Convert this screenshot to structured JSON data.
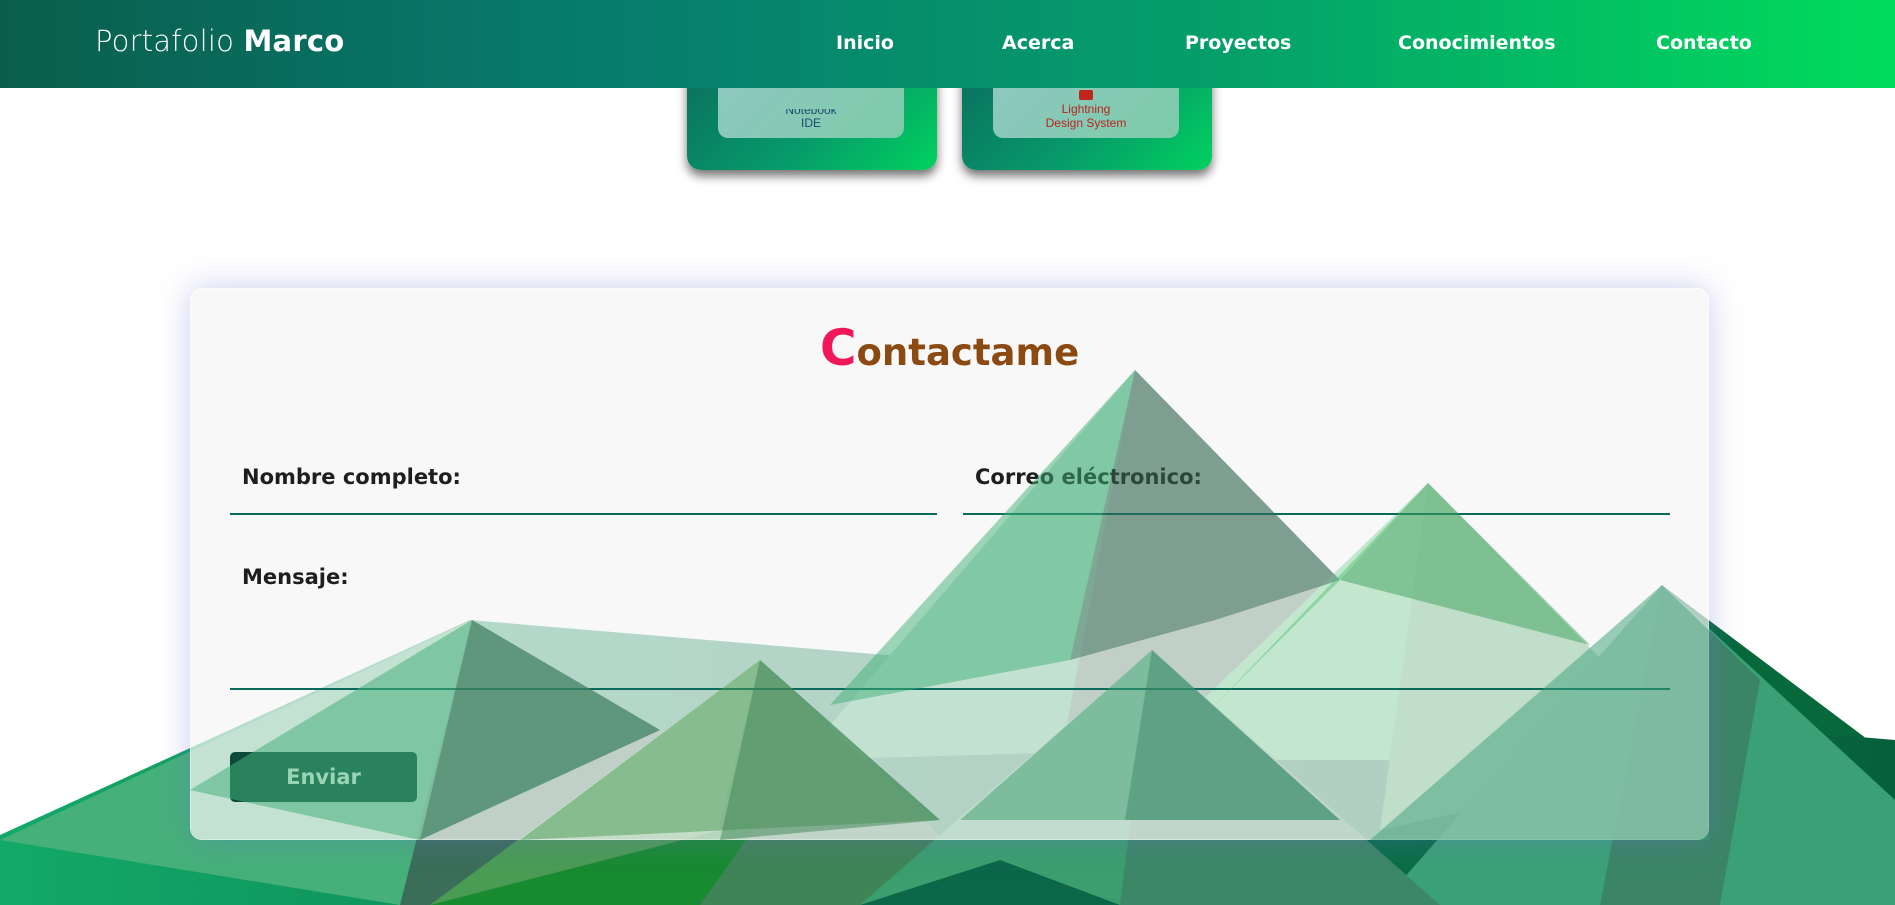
{
  "header": {
    "brand_light": "Portafolio",
    "brand_bold": "Marco",
    "nav": [
      {
        "label": "Inicio"
      },
      {
        "label": "Acerca"
      },
      {
        "label": "Proyectos"
      },
      {
        "label": "Conocimientos"
      },
      {
        "label": "Contacto"
      }
    ]
  },
  "projects": [
    {
      "label_line1": "Notebook",
      "label_line2": "IDE"
    },
    {
      "label_line1": "Lightning",
      "label_line2": "Design System"
    }
  ],
  "contact": {
    "title_first": "C",
    "title_rest": "ontactame",
    "name_label": "Nombre completo:",
    "email_label": "Correo eléctronico:",
    "message_label": "Mensaje:",
    "send_label": "Enviar"
  },
  "colors": {
    "header_start": "#0a5e4c",
    "header_end": "#00dc5c",
    "title_accent": "#f0185a",
    "title_main": "#8b4a12",
    "button": "#0b4a3a"
  }
}
